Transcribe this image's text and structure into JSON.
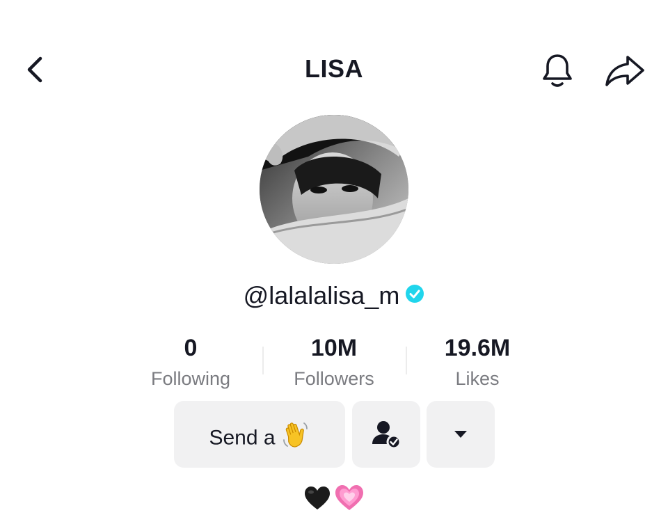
{
  "header": {
    "title": "LISA",
    "back_icon": "chevron-left-icon",
    "notification_icon": "bell-icon",
    "share_icon": "share-arrow-icon"
  },
  "profile": {
    "avatar": "profile-photo",
    "username": "@lalalalisa_m",
    "verified": true,
    "verified_color": "#20d5ec"
  },
  "stats": [
    {
      "value": "0",
      "label": "Following"
    },
    {
      "value": "10M",
      "label": "Followers"
    },
    {
      "value": "19.6M",
      "label": "Likes"
    }
  ],
  "actions": {
    "send_label": "Send a",
    "send_icon": "waving-hand-icon",
    "friends_icon": "person-check-icon",
    "more_icon": "caret-down-icon"
  },
  "bio": {
    "icons": [
      "black-heart-icon",
      "growing-pink-heart-icon"
    ]
  }
}
